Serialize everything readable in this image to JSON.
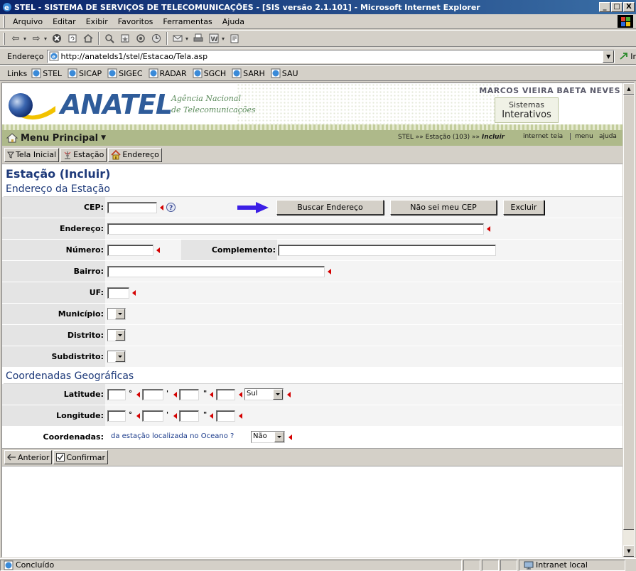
{
  "window": {
    "title": "STEL - SISTEMA DE SERVIÇOS DE TELECOMUNICAÇÕES - [SIS versão 2.1.101] - Microsoft Internet Explorer",
    "buttons": [
      "_",
      "□",
      "X"
    ]
  },
  "menubar": {
    "items": [
      "Arquivo",
      "Editar",
      "Exibir",
      "Favoritos",
      "Ferramentas",
      "Ajuda"
    ]
  },
  "addressbar": {
    "label": "Endereço",
    "url": "http://anatelds1/stel/Estacao/Tela.asp",
    "go_label": "Ir"
  },
  "linksbar": {
    "label": "Links",
    "items": [
      "STEL",
      "SICAP",
      "SIGEC",
      "RADAR",
      "SGCH",
      "SARH",
      "SAU"
    ]
  },
  "header": {
    "brand": "ANATEL",
    "agency_line1": "Agência Nacional",
    "agency_line2": "de Telecomunicações",
    "user": "MARCOS VIEIRA BAETA NEVES",
    "systems_line1": "Sistemas",
    "systems_line2": "Interativos",
    "menu_principal": "Menu Principal",
    "breadcrumb_prefix": "STEL »» Estação (103) »»",
    "breadcrumb_current": "Incluir",
    "nav_links": [
      "internet",
      "teia",
      "menu",
      "ajuda"
    ]
  },
  "topbuttons": [
    "Tela Inicial",
    "Estação",
    "Endereço"
  ],
  "form": {
    "title": "Estação (Incluir)",
    "section_address": "Endereço da Estação",
    "cep_label": "CEP:",
    "buscar_label": "Buscar Endereço",
    "nao_sei_cep_label": "Não sei meu CEP",
    "excluir_label": "Excluir",
    "endereco_label": "Endereço:",
    "numero_label": "Número:",
    "complemento_label": "Complemento:",
    "bairro_label": "Bairro:",
    "uf_label": "UF:",
    "municipio_label": "Município:",
    "distrito_label": "Distrito:",
    "subdistrito_label": "Subdistrito:",
    "section_coords": "Coordenadas Geográficas",
    "latitude_label": "Latitude:",
    "longitude_label": "Longitude:",
    "coordenadas_label": "Coordenadas:",
    "hemisphere_value": "Sul",
    "ocean_question": "da estação localizada no Oceano ?",
    "ocean_value": "Não",
    "degree_symbol": "°",
    "minute_symbol": "'",
    "second_symbol": "\""
  },
  "bottombuttons": [
    "Anterior",
    "Confirmar"
  ],
  "statusbar": {
    "status": "Concluído",
    "zone": "Intranet local"
  },
  "colors": {
    "title_blue": "#1e3a7a",
    "required_marker": "#d40000",
    "nav_green": "#aeb98a",
    "arrow_blue": "#3c1fe6"
  }
}
